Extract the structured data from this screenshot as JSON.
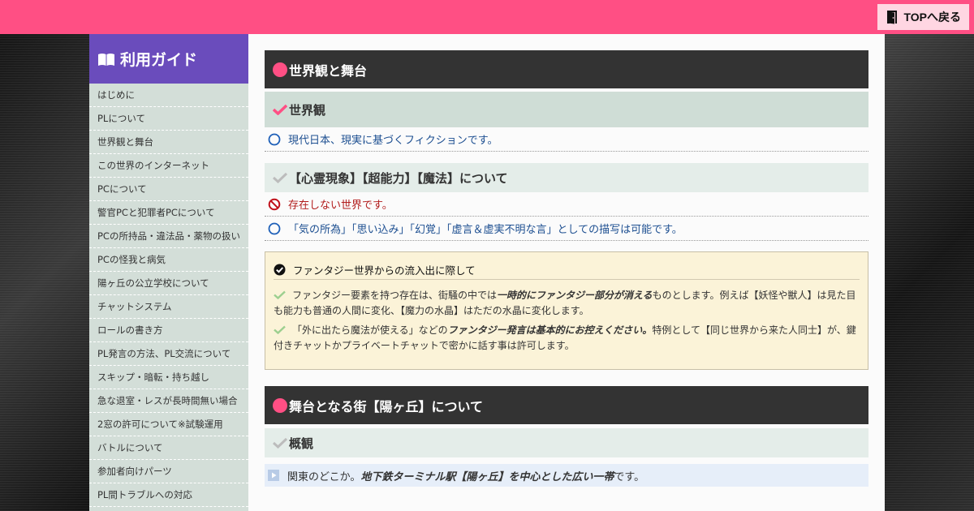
{
  "header": {
    "top_button_label": "TOPへ戻る"
  },
  "sidebar": {
    "title": "利用ガイド",
    "items": [
      "はじめに",
      "PLについて",
      "世界観と舞台",
      "この世界のインターネット",
      "PCについて",
      "警官PCと犯罪者PCについて",
      "PCの所持品・違法品・薬物の扱い",
      "PCの怪我と病気",
      "陽ヶ丘の公立学校について",
      "チャットシステム",
      "ロールの書き方",
      "PL発言の方法、PL交流について",
      "スキップ・暗転・持ち越し",
      "急な退室・レスが長時間無い場合",
      "2窓の許可について※試験運用",
      "バトルについて",
      "参加者向けパーツ",
      "PL間トラブルへの対応"
    ]
  },
  "main": {
    "section1": {
      "title": "世界観と舞台",
      "sub1": {
        "title": "世界観",
        "row": "現代日本、現実に基づくフィクションです。"
      },
      "sub2": {
        "title": "【心霊現象】【超能力】【魔法】について",
        "row_no": "存在しない世界です。",
        "row_ok": "「気の所為」「思い込み」「幻覚」「虚言＆虚実不明な言」としての描写は可能です。"
      },
      "note": {
        "title": "ファンタジー世界からの流入出に際して",
        "p1_pre": "ファンタジー要素を持つ存在は、街騒の中では",
        "p1_bold": "一時的にファンタジー部分が消える",
        "p1_post": "ものとします。例えば【妖怪や獣人】は見た目も能力も普通の人間に変化、【魔力の水晶】はただの水晶に変化します。",
        "p2_pre": "「外に出たら魔法が使える」などの",
        "p2_bold": "ファンタジー発言は基本的にお控えください。",
        "p2_post": "特例として【同じ世界から来た人同士】が、鍵付きチャットかプライベートチャットで密かに話す事は許可します。"
      }
    },
    "section2": {
      "title": "舞台となる街【陽ヶ丘】について",
      "sub1": {
        "title": "概観",
        "row_pre": "関東のどこか。",
        "row_bold": "地下鉄ターミナル駅【陽ヶ丘】を中心とした広い一帯",
        "row_post": "です。"
      }
    }
  },
  "colors": {
    "accent_pink": "#ff4f84",
    "sidebar_head": "#6a4cbc",
    "heading_dark": "#333333"
  },
  "icons": [
    "door-icon",
    "book-icon",
    "check-icon",
    "circle-icon",
    "prohibited-icon",
    "check-circle-icon",
    "play-icon"
  ]
}
